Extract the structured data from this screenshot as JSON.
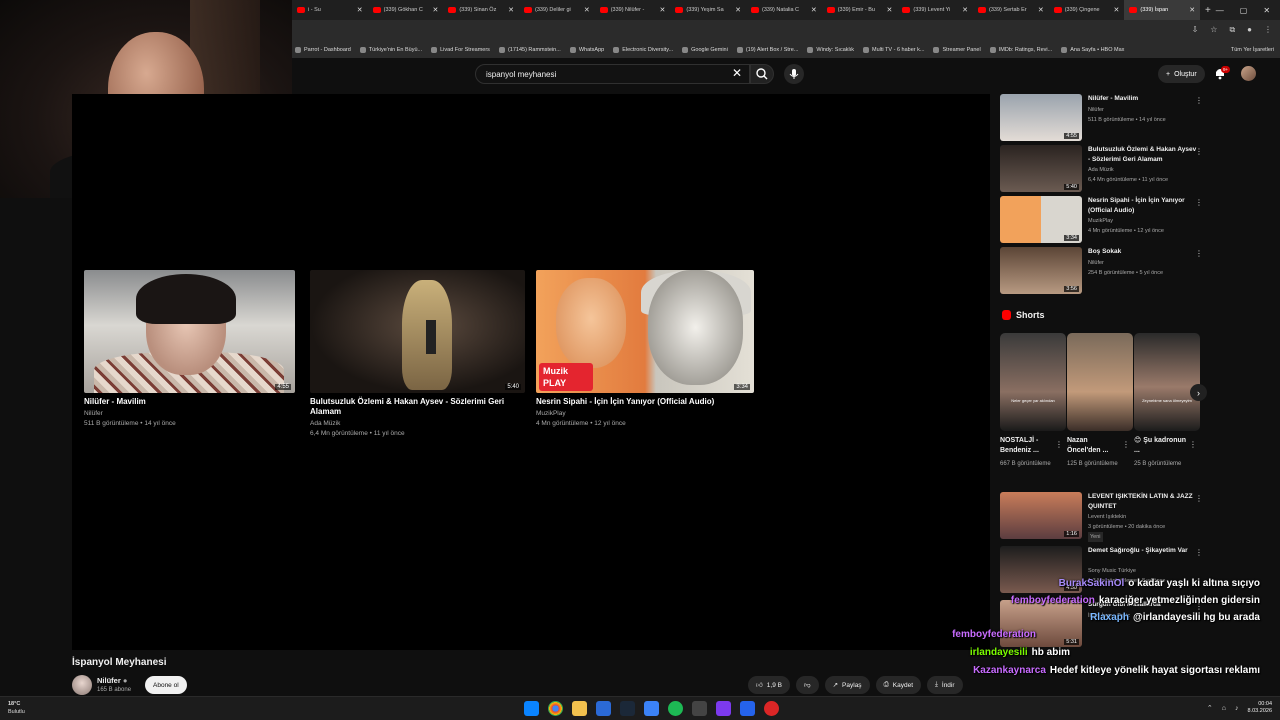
{
  "browser": {
    "tabs": [
      {
        "label": "i - Su"
      },
      {
        "label": "(339) Gökhan C"
      },
      {
        "label": "(339) Sinan Öz"
      },
      {
        "label": "(339) Deliler gi"
      },
      {
        "label": "(339) Nilüfer -"
      },
      {
        "label": "(339) Yeşim Sa"
      },
      {
        "label": "(339) Natalia C"
      },
      {
        "label": "(339) Emir - Bu"
      },
      {
        "label": "(339) Levent Yi"
      },
      {
        "label": "(339) Sertab Er"
      },
      {
        "label": "(339) Çingene"
      },
      {
        "label": "(339) İspan"
      }
    ],
    "bookmarks": [
      "Parrot - Dashboard",
      "Türkiye'nin En Büyü...",
      "Livad For Streamers",
      "(17145) Rammstein...",
      "WhatsApp",
      "Electronic Diversity...",
      "Google Gemini",
      "(19) Alert Box / Stre...",
      "Windy: Sıcaklık",
      "Multi TV - 6 haber k...",
      "Streamer Panel",
      "IMDb: Ratings, Revi...",
      "Ana Sayfa • HBO Max"
    ],
    "all_bookmarks": "Tüm Yer İşaretleri"
  },
  "header": {
    "search_value": "ispanyol meyhanesi",
    "create_label": "Oluştur",
    "notif_badge": "9+"
  },
  "endcards": [
    {
      "title": "Nilüfer - Mavilim",
      "channel": "Nilüfer",
      "meta": "511 B görüntüleme • 14 yıl önce",
      "duration": "4:55"
    },
    {
      "title": "Bulutsuzluk Özlemi & Hakan Aysev - Sözlerimi Geri Alamam",
      "channel": "Ada Müzik",
      "meta": "6,4 Mn görüntüleme • 11 yıl önce",
      "duration": "5:40"
    },
    {
      "title": "Nesrin Sipahi - İçin İçin Yanıyor (Official Audio)",
      "channel": "MuzikPlay",
      "meta": "4 Mn görüntüleme • 12 yıl önce",
      "duration": "3:34",
      "badge_line1": "Muzik",
      "badge_line2": "PLAY"
    }
  ],
  "video": {
    "title": "İspanyol Meyhanesi",
    "channel": "Nilüfer",
    "subs": "165 B abone",
    "subscribe_label": "Abone ol",
    "likes": "1,9 B",
    "share_label": "Paylaş",
    "save_label": "Kaydet",
    "download_label": "İndir"
  },
  "sidebar": {
    "items": [
      {
        "title": "Nilüfer - Mavilim",
        "channel": "Nilüfer",
        "meta": "511 B görüntüleme • 14 yıl önce",
        "duration": "4:55"
      },
      {
        "title": "Bulutsuzluk Özlemi & Hakan Aysev - Sözlerimi Geri Alamam",
        "channel": "Ada Müzik",
        "meta": "6,4 Mn görüntüleme • 11 yıl önce",
        "duration": "5:40"
      },
      {
        "title": "Nesrin Sipahi - İçin İçin Yanıyor (Official Audio)",
        "channel": "MuzikPlay",
        "meta": "4 Mn görüntüleme • 12 yıl önce",
        "duration": "3:34"
      },
      {
        "title": "Boş Sokak",
        "channel": "Nilüfer",
        "meta": "254 B görüntüleme • 5 yıl önce",
        "duration": "3:56"
      },
      {
        "title": "LEVENT IŞIKTEKİN LATIN & JAZZ QUINTET",
        "channel": "Levent Işıktekin",
        "meta": "3 görüntüleme • 20 dakika önce",
        "badge": "Yeni",
        "duration": "1:16"
      },
      {
        "title": "Demet Sağıroğlu - Şikayetim Var",
        "channel": "Sony Music Türkiye",
        "meta": "1,3 Mn görüntüleme • 8 yıl önce",
        "duration": "4:50"
      },
      {
        "title": "Sürgün Gibi Masallarda",
        "channel": "İlhan İrem - Topic",
        "meta": "",
        "duration": "5:31"
      }
    ],
    "shorts_heading": "Shorts",
    "shorts": [
      {
        "title": "NOSTALJİ - Bendeniz ...",
        "views": "667 B görüntüleme",
        "caption": "Neler geçer yar aklından"
      },
      {
        "title": "Nazan Öncel'den ...",
        "views": "125 B görüntüleme",
        "caption": ""
      },
      {
        "title": "😊 Şu kadronun ...",
        "views": "25 B görüntüleme",
        "caption": "Zeynebime sana ölmeyeyim"
      }
    ]
  },
  "chat": [
    {
      "user": "BurakSakinOl",
      "msg": "o kadar yaşlı ki altına sıçıyo",
      "color": "#a78bfa"
    },
    {
      "user": "femboyfederation",
      "msg": "karaciğer yetmezliğinden gidersin",
      "color": "#c86cff"
    },
    {
      "user": "Rlaxaph",
      "msg": "@irlandayesili hg bu arada",
      "color": "#7ab8ff"
    },
    {
      "user": "femboyfederation",
      "msg": "",
      "color": "#c86cff"
    },
    {
      "user": "irlandayesili",
      "msg": "hb abim",
      "color": "#7cfc00"
    },
    {
      "user": "Kazankaynarca",
      "msg": "Hedef kitleye yönelik hayat sigortası reklamı",
      "color": "#c86cff"
    },
    {
      "user": "femboyfederation",
      "msg": "",
      "color": "#c86cff"
    }
  ],
  "taskbar": {
    "temp": "18°C",
    "weather": "Bulutlu",
    "time": "00:04",
    "date": "8.03.2026"
  }
}
